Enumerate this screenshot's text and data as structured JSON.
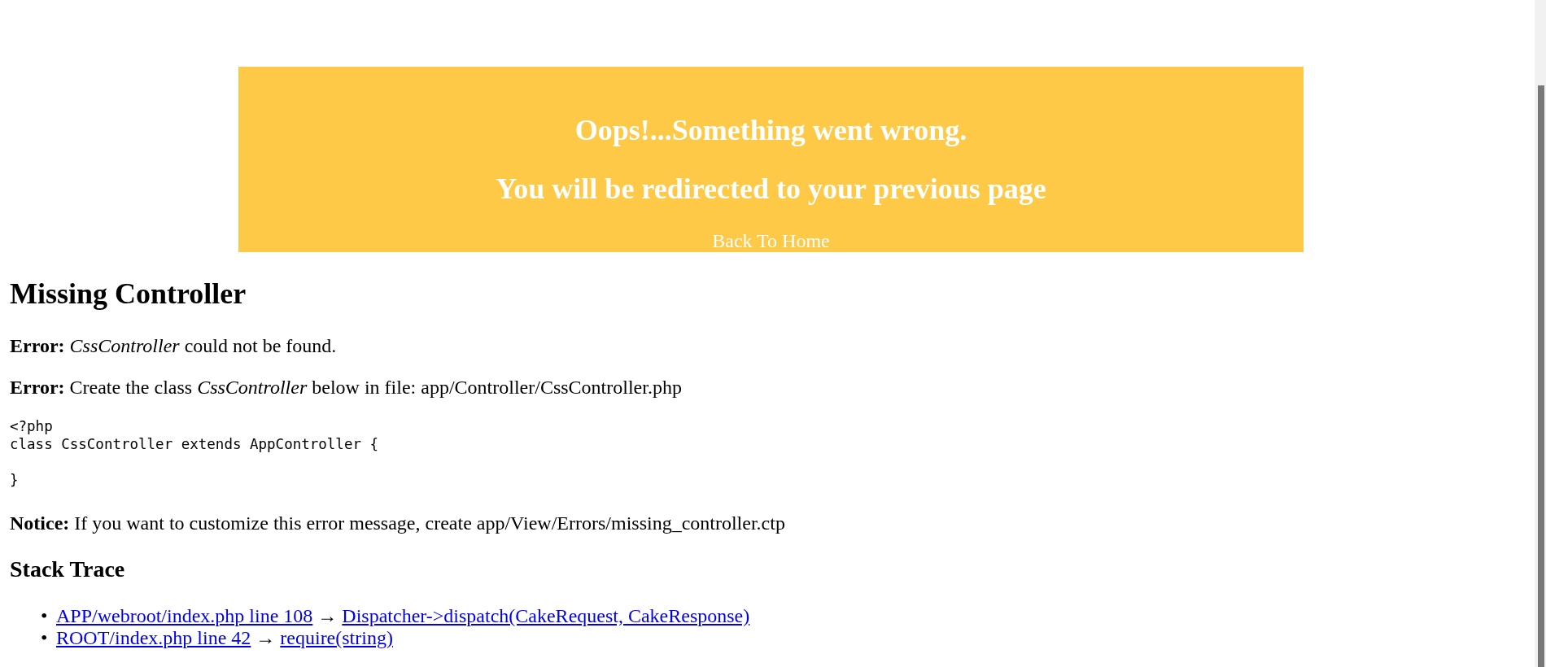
{
  "banner": {
    "title": "Oops!...Something went wrong.",
    "subtitle": "You will be redirected to your previous page",
    "home_link": "Back To Home"
  },
  "heading": "Missing Controller",
  "messages": [
    {
      "label": "Error:",
      "text": "*CssController* could not be found."
    },
    {
      "label": "Error:",
      "text": "Create the class *CssController* below in file: app/Controller/CssController.php"
    }
  ],
  "code": "<?php\nclass CssController extends AppController {\n\n}",
  "notice": {
    "label": "Notice:",
    "text": "If you want to customize this error message, create app/View/Errors/missing_controller.ctp"
  },
  "stack_trace": {
    "title": "Stack Trace",
    "items": [
      {
        "marker": "•",
        "file": "APP/webroot/index.php line 108",
        "separator": "→",
        "call": "Dispatcher->dispatch(CakeRequest, CakeResponse)"
      },
      {
        "marker": "•",
        "file": "ROOT/index.php line 42",
        "separator": "→",
        "call": "require(string)"
      }
    ]
  }
}
